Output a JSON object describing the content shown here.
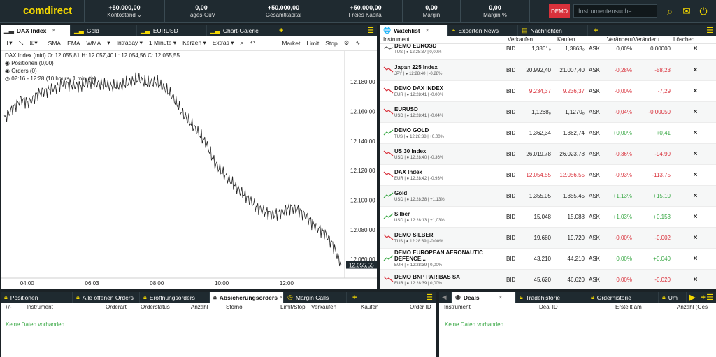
{
  "header": {
    "logo": "comdirect",
    "stats": [
      {
        "value": "+50.000,00",
        "label": "Kontostand ⌄"
      },
      {
        "value": "0,00",
        "label": "Tages-GuV"
      },
      {
        "value": "+50.000,00",
        "label": "Gesamtkapital"
      },
      {
        "value": "+50.000,00",
        "label": "Freies Kapital"
      },
      {
        "value": "0,00",
        "label": "Margin"
      },
      {
        "value": "0,00",
        "label": "Margin %"
      }
    ],
    "demo_label": "DEMO",
    "search_placeholder": "Instrumentensuche"
  },
  "chart_panel": {
    "tabs": [
      "DAX Index",
      "Gold",
      "EURUSD",
      "Chart-Galerie"
    ],
    "toolbar": [
      "T▾",
      "⤡",
      "⊞▾",
      "SMA",
      "EMA",
      "WMA",
      "▾",
      "Intraday ▾",
      "1 Minute ▾",
      "Kerzen ▾",
      "Extras ▾"
    ],
    "toolbar_right": [
      "Market",
      "Limit",
      "Stop"
    ],
    "info_line": "DAX Index (mid)  O: 12.055,81  H: 12.057,40  L: 12.054,56  C: 12.055,55",
    "positions": "Positionen (0,00)",
    "orders": "Orders (0)",
    "range": "02:16 - 12:28  (10 hours, 1 minute)",
    "current_price": "12.055,55"
  },
  "chart_data": {
    "type": "line",
    "title": "DAX Index (mid)",
    "x_ticks": [
      "04:00",
      "06:03",
      "08:00",
      "10:00",
      "12:00"
    ],
    "y_ticks": [
      "12.180,00",
      "12.160,00",
      "12.140,00",
      "12.120,00",
      "12.100,00",
      "12.080,00",
      "12.060,00"
    ],
    "ylim": [
      12052,
      12190
    ],
    "x": [
      0,
      10,
      20,
      30,
      40,
      50,
      60,
      70,
      80,
      90,
      100,
      110,
      120,
      130,
      140,
      150,
      160,
      170,
      180,
      190,
      200,
      210,
      220,
      230,
      240,
      250,
      260,
      270,
      280,
      290,
      300,
      310,
      320,
      330,
      340,
      350,
      360,
      370,
      380,
      390,
      400
    ],
    "values": [
      12155,
      12162,
      12168,
      12166,
      12172,
      12174,
      12176,
      12179,
      12178,
      12177,
      12180,
      12179,
      12178,
      12177,
      12178,
      12180,
      12182,
      12179,
      12180,
      12176,
      12170,
      12160,
      12153,
      12146,
      12138,
      12125,
      12118,
      12112,
      12106,
      12101,
      12095,
      12092,
      12090,
      12092,
      12095,
      12093,
      12088,
      12082,
      12078,
      12070,
      12056
    ]
  },
  "watchlist_panel": {
    "tabs": [
      "Watchlist",
      "Experten News",
      "Nachrichten"
    ],
    "columns": [
      "Instrument",
      "Verkaufen",
      "Kaufen",
      "Veränderu",
      "Veränderu",
      "Löschen"
    ],
    "rows": [
      {
        "name": "DEMO EUROSD",
        "sub": "TUS | ● 12:28:37 | 0,00%",
        "sell": "1,3861₀",
        "buy": "1,3863₀",
        "chg": "0,00%",
        "chg2": "0,00000",
        "dir": "flat"
      },
      {
        "name": "Japan 225 Index",
        "sub": "JPY | ● 12:28:40 | -0,28%",
        "sell": "20.992,40",
        "buy": "21.007,40",
        "chg": "-0,28%",
        "chg2": "-58,23",
        "dir": "neg"
      },
      {
        "name": "DEMO DAX INDEX",
        "sub": "EUR | ● 12:28:41 | -0,00%",
        "sell": "9.234,37",
        "buy": "9.236,37",
        "chg": "-0,00%",
        "chg2": "-7,29",
        "dir": "neg",
        "red": true
      },
      {
        "name": "EURUSD",
        "sub": "USD | ● 12:28:41 | -0,04%",
        "sell": "1,1268₈",
        "buy": "1,1270₈",
        "chg": "-0,04%",
        "chg2": "-0,00050",
        "dir": "neg"
      },
      {
        "name": "DEMO GOLD",
        "sub": "TUS | ● 12:28:38 | +0,00%",
        "sell": "1.362,34",
        "buy": "1.362,74",
        "chg": "+0,00%",
        "chg2": "+0,41",
        "dir": "pos"
      },
      {
        "name": "US 30 Index",
        "sub": "USD | ● 12:28:40 | -0,36%",
        "sell": "26.019,78",
        "buy": "26.023,78",
        "chg": "-0,36%",
        "chg2": "-94,90",
        "dir": "neg"
      },
      {
        "name": "DAX Index",
        "sub": "EUR | ● 12:28:42 | -0,93%",
        "sell": "12.054,55",
        "buy": "12.056,55",
        "chg": "-0,93%",
        "chg2": "-113,75",
        "dir": "neg",
        "red": true
      },
      {
        "name": "Gold",
        "sub": "USD | ● 12:28:38 | +1,13%",
        "sell": "1.355,05",
        "buy": "1.355,45",
        "chg": "+1,13%",
        "chg2": "+15,10",
        "dir": "pos"
      },
      {
        "name": "Silber",
        "sub": "USD | ● 12:28:13 | +1,03%",
        "sell": "15,048",
        "buy": "15,088",
        "chg": "+1,03%",
        "chg2": "+0,153",
        "dir": "pos"
      },
      {
        "name": "DEMO SILBER",
        "sub": "TUS | ● 12:28:39 | -0,00%",
        "sell": "19,680",
        "buy": "19,720",
        "chg": "-0,00%",
        "chg2": "-0,002",
        "dir": "neg"
      },
      {
        "name": "DEMO EUROPEAN AERONAUTIC DEFENCE...",
        "sub": "EUR | ● 12:28:39 | 0,00%",
        "sell": "43,210",
        "buy": "44,210",
        "chg": "0,00%",
        "chg2": "+0,040",
        "dir": "pos"
      },
      {
        "name": "DEMO BNP PARIBAS SA",
        "sub": "EUR | ● 12:28:39 | 0,00%",
        "sell": "45,620",
        "buy": "46,620",
        "chg": "0,00%",
        "chg2": "-0,020",
        "dir": "neg"
      }
    ],
    "bid": "BID",
    "ask": "ASK",
    "delete": "×"
  },
  "orders_panel": {
    "tabs": [
      "Positionen",
      "Alle offenen Orders",
      "Eröffnungsorders",
      "Absicherungsorders",
      "Margin Calls"
    ],
    "columns": [
      "+/-",
      "Instrument",
      "Orderart",
      "Orderstatus",
      "Anzahl",
      "Storno",
      "Limit/Stop",
      "Verkaufen",
      "Kaufen",
      "Order ID"
    ],
    "empty": "Keine Daten vorhanden..."
  },
  "deals_panel": {
    "tabs": [
      "Deals",
      "Tradehistorie",
      "Orderhistorie",
      "Um"
    ],
    "columns": [
      "Instrument",
      "Deal ID",
      "Erstellt am",
      "Anzahl (Ges"
    ],
    "empty": "Keine Daten vorhanden..."
  },
  "colors": {
    "accent": "#f5d800",
    "negative": "#d9313b",
    "positive": "#39a845",
    "bar": "#1f2a30"
  }
}
